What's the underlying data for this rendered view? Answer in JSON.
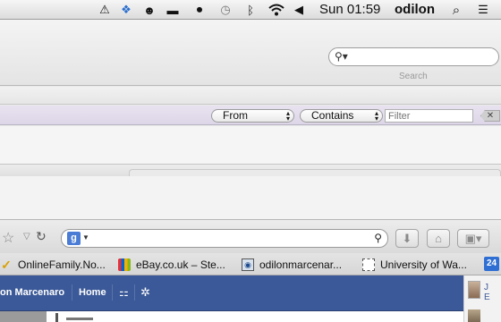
{
  "menubar": {
    "icons": [
      "alert-icon",
      "dropbox-icon",
      "agent-icon",
      "minus-icon",
      "record-icon",
      "time-machine-icon",
      "bluetooth-icon",
      "wifi-icon",
      "volume-icon",
      "spotlight-icon",
      "notification-center-icon"
    ],
    "clock": "Sun 01:59",
    "user": "odilon"
  },
  "mail": {
    "search_caption": "Search",
    "filter": {
      "field_option": "From",
      "match_option": "Contains",
      "placeholder": "Filter"
    }
  },
  "firefox": {
    "toolbar_icons": [
      "bookmark-star-icon",
      "dropdown-icon",
      "reload-icon",
      "google-icon",
      "download-icon",
      "home-icon",
      "bookmarks-menu-icon"
    ],
    "bookmarks": [
      {
        "label": "OnlineFamily.No...",
        "icon": "check-icon"
      },
      {
        "label": "eBay.co.uk – Ste...",
        "icon": "ebay-icon"
      },
      {
        "label": "odilonmarcenar...",
        "icon": "site-icon"
      },
      {
        "label": "University of Wa...",
        "icon": "page-icon"
      }
    ],
    "calendar_badge": "24"
  },
  "facebook": {
    "profile_name": "on Marcenaro",
    "home_label": "Home",
    "side_text": "J\nE"
  }
}
